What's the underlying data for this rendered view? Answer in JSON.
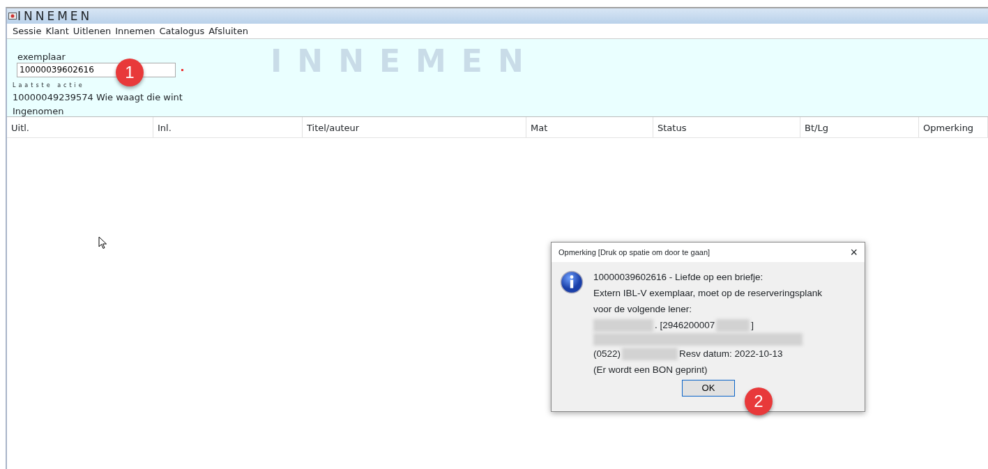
{
  "window": {
    "title": "INNEMEN"
  },
  "menu": [
    "Sessie",
    "Klant",
    "Uitlenen",
    "Innemen",
    "Catalogus",
    "Afsluiten"
  ],
  "form": {
    "label": "exemplaar",
    "value": "10000039602616",
    "banner": "INNEMEN",
    "last_action_label": "Laatste actie",
    "last_action": "10000049239574 Wie waagt die wint",
    "last_status": "Ingenomen"
  },
  "table": {
    "columns": [
      "Uitl.",
      "Inl.",
      "Titel/auteur",
      "Mat",
      "Status",
      "Bt/Lg",
      "Opmerking"
    ]
  },
  "dialog": {
    "title": "Opmerking [Druk op spatie om door te gaan]",
    "close": "×",
    "lines": [
      [
        {
          "kind": "text",
          "text": "10000039602616 - Liefde op een briefje:"
        }
      ],
      [
        {
          "kind": "text",
          "text": "Extern IBL-V exemplaar, moet op de reserveringsplank"
        }
      ],
      [
        {
          "kind": "text",
          "text": "voor de volgende lener:"
        }
      ],
      [
        {
          "kind": "redacted"
        },
        {
          "kind": "text",
          "text": ". [2946200007"
        },
        {
          "kind": "redacted"
        },
        {
          "kind": "text",
          "text": "]"
        }
      ],
      [
        {
          "kind": "redacted"
        }
      ],
      [
        {
          "kind": "text",
          "text": "(0522)"
        },
        {
          "kind": "redacted"
        },
        {
          "kind": "text",
          "text": "Resv datum: 2022-10-13"
        }
      ],
      [
        {
          "kind": "text",
          "text": "(Er wordt een BON geprint)"
        }
      ]
    ],
    "button": "OK"
  },
  "annotations": [
    "1",
    "2"
  ]
}
